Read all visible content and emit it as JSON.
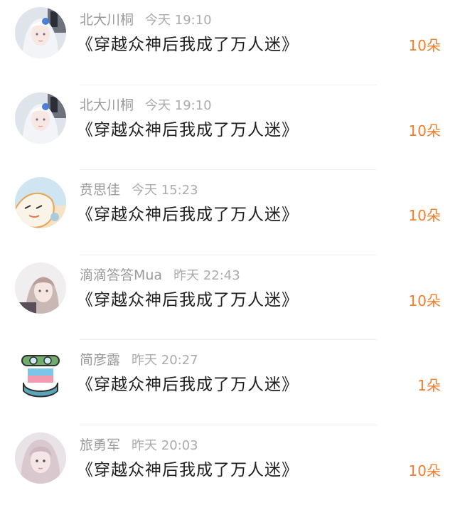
{
  "colors": {
    "accent": "#f07d2a",
    "username": "#9a9a9a",
    "time": "#ababab",
    "title": "#1f1f1f"
  },
  "items": [
    {
      "username": "北大川桐",
      "time": "今天 19:10",
      "title": "《穿越众神后我成了万人迷》",
      "amount": "10朵",
      "avatar": "anime-girl-white-hair-avatar"
    },
    {
      "username": "北大川桐",
      "time": "今天 19:10",
      "title": "《穿越众神后我成了万人迷》",
      "amount": "10朵",
      "avatar": "anime-girl-white-hair-avatar"
    },
    {
      "username": "贲思佳",
      "time": "今天 15:23",
      "title": "《穿越众神后我成了万人迷》",
      "amount": "10朵",
      "avatar": "cartoon-character-avatar"
    },
    {
      "username": "滴滴答答Mua",
      "time": "昨天 22:43",
      "title": "《穿越众神后我成了万人迷》",
      "amount": "10朵",
      "avatar": "anime-boy-avatar"
    },
    {
      "username": "简彦露",
      "time": "昨天 20:27",
      "title": "《穿越众神后我成了万人迷》",
      "amount": "1朵",
      "avatar": "cartoon-goggles-avatar"
    },
    {
      "username": "旅勇军",
      "time": "昨天 20:03",
      "title": "《穿越众神后我成了万人迷》",
      "amount": "10朵",
      "avatar": "girl-photo-avatar"
    }
  ]
}
